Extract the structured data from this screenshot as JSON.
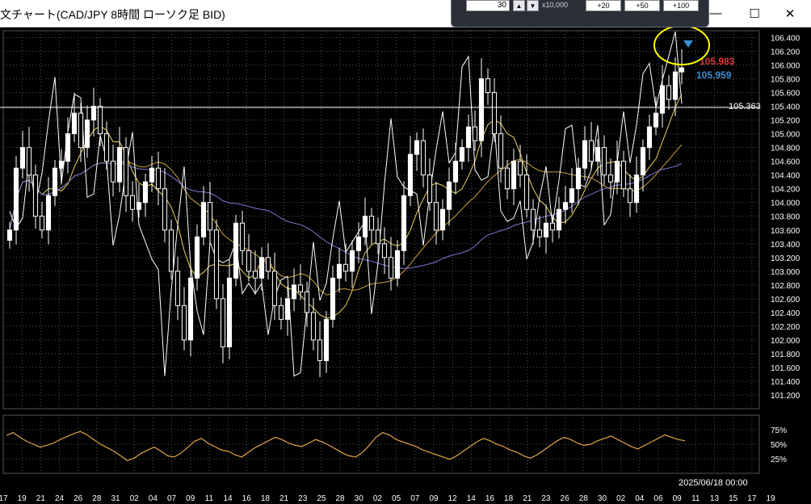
{
  "window": {
    "title": "文チャート(CAD/JPY 8時間 ローソク足 BID)",
    "minimize_icon": "minimize-icon",
    "maximize_icon": "maximize-icon",
    "close_icon": "close-icon"
  },
  "order_panel": {
    "quantity": "30",
    "multiplier": "x10,000",
    "buttons": [
      "+20",
      "+50",
      "+100"
    ]
  },
  "chart_data": {
    "type": "line",
    "title": "",
    "xlabel": "",
    "ylabel": "",
    "ylim": [
      101.0,
      106.5
    ],
    "y_ticks": [
      "106.400",
      "106.200",
      "106.000",
      "105.800",
      "105.600",
      "105.400",
      "105.200",
      "105.000",
      "104.800",
      "104.600",
      "104.400",
      "104.200",
      "104.000",
      "103.800",
      "103.600",
      "103.400",
      "103.200",
      "103.000",
      "102.800",
      "102.600",
      "102.400",
      "102.200",
      "102.000",
      "101.800",
      "101.600",
      "101.400",
      "101.200"
    ],
    "x_ticks": [
      "17",
      "19",
      "21",
      "24",
      "26",
      "28",
      "31",
      "02",
      "04",
      "07",
      "09",
      "11",
      "14",
      "16",
      "18",
      "21",
      "23",
      "25",
      "28",
      "30",
      "02",
      "05",
      "07",
      "09",
      "12",
      "14",
      "16",
      "18",
      "21",
      "23",
      "26",
      "28",
      "30",
      "02",
      "04",
      "06",
      "09",
      "11",
      "13",
      "15",
      "17",
      "19"
    ],
    "date_label": "2025/06/18 00:00",
    "price_line_label": "105.363",
    "ask_label": "105.983",
    "bid_label": "105.959",
    "ask_color": "#e5383b",
    "bid_color": "#3b8fd4",
    "grid": true,
    "candle_closes": [
      103.6,
      104.5,
      104.8,
      104.4,
      103.8,
      103.6,
      104.1,
      104.5,
      104.6,
      105.0,
      105.3,
      104.8,
      105.2,
      105.4,
      105.0,
      104.6,
      104.3,
      104.8,
      104.1,
      103.9,
      104.0,
      104.3,
      104.5,
      104.2,
      103.6,
      103.0,
      102.5,
      102.0,
      102.9,
      103.5,
      104.0,
      103.6,
      102.6,
      101.9,
      102.9,
      103.7,
      103.3,
      103.0,
      102.9,
      103.2,
      103.0,
      102.5,
      102.3,
      102.6,
      102.8,
      102.7,
      102.4,
      102.0,
      101.7,
      102.3,
      102.9,
      103.1,
      103.0,
      103.3,
      103.5,
      103.8,
      103.6,
      103.4,
      103.2,
      102.9,
      103.3,
      104.1,
      104.7,
      104.9,
      104.4,
      104.0,
      103.6,
      103.9,
      104.3,
      104.6,
      104.8,
      105.1,
      104.9,
      105.8,
      105.6,
      105.0,
      104.5,
      104.2,
      104.6,
      104.4,
      103.9,
      103.6,
      103.5,
      103.7,
      103.6,
      103.9,
      104.0,
      104.2,
      104.5,
      104.9,
      104.6,
      104.8,
      104.4,
      104.3,
      104.6,
      104.2,
      104.0,
      104.4,
      104.8,
      105.1,
      105.3,
      105.7,
      105.5,
      105.9,
      105.96
    ],
    "rsi_y_labels": [
      "75%",
      "50%",
      "25%"
    ],
    "rsi_values": [
      65,
      70,
      62,
      55,
      50,
      45,
      48,
      52,
      58,
      63,
      68,
      72,
      66,
      58,
      50,
      44,
      38,
      30,
      22,
      26,
      34,
      40,
      45,
      38,
      30,
      28,
      35,
      45,
      55,
      60,
      52,
      46,
      40,
      38,
      32,
      28,
      36,
      44,
      50,
      56,
      62,
      58,
      52,
      48,
      46,
      52,
      58,
      54,
      48,
      42,
      35,
      30,
      28,
      36,
      48,
      62,
      70,
      66,
      58,
      54,
      50,
      46,
      40,
      36,
      32,
      28,
      24,
      30,
      38,
      46,
      54,
      60,
      56,
      50,
      46,
      40,
      36,
      30,
      26,
      32,
      40,
      48,
      56,
      62,
      58,
      52,
      48,
      50,
      56,
      60,
      64,
      58,
      52,
      46,
      42,
      48,
      54,
      60,
      66,
      62,
      58,
      56
    ]
  }
}
